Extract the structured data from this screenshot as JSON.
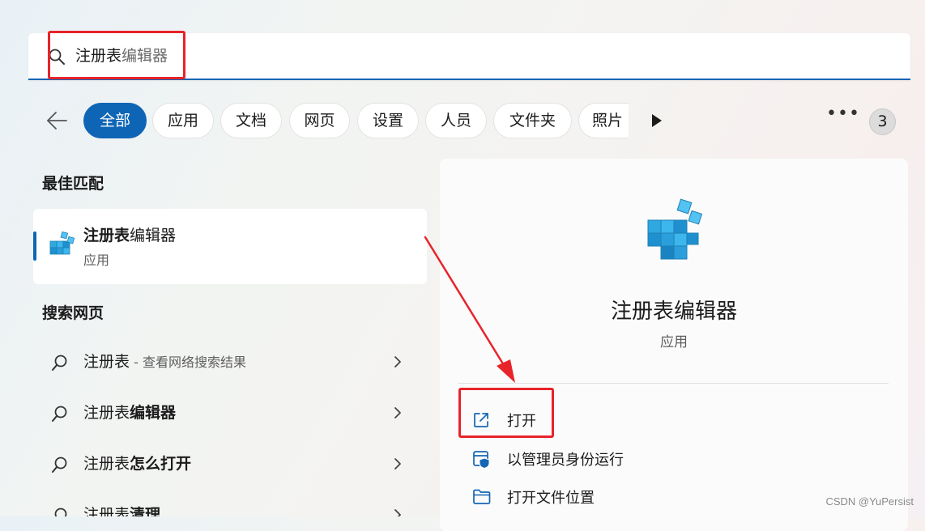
{
  "search": {
    "typed": "注册表",
    "suggestion": "编辑器"
  },
  "filters": {
    "items": [
      "全部",
      "应用",
      "文档",
      "网页",
      "设置",
      "人员",
      "文件夹",
      "照片"
    ],
    "active": "全部",
    "more_label": "•••",
    "count_badge": "3"
  },
  "best_match": {
    "section_title": "最佳匹配",
    "name_highlight": "注册表",
    "name_rest": "编辑器",
    "type": "应用"
  },
  "web_search": {
    "section_title": "搜索网页",
    "results": [
      {
        "prefix": "注册表",
        "suffix": "",
        "hint": " - 查看网络搜索结果"
      },
      {
        "prefix": "注册表",
        "suffix": "编辑器",
        "hint": ""
      },
      {
        "prefix": "注册表",
        "suffix": "怎么打开",
        "hint": ""
      },
      {
        "prefix": "注册表",
        "suffix": "清理",
        "hint": ""
      }
    ]
  },
  "detail": {
    "name": "注册表编辑器",
    "type": "应用",
    "actions": [
      {
        "label": "打开",
        "icon": "open-external-icon"
      },
      {
        "label": "以管理员身份运行",
        "icon": "run-as-admin-icon"
      },
      {
        "label": "打开文件位置",
        "icon": "folder-icon"
      }
    ]
  },
  "colors": {
    "accent": "#0f65b5",
    "annotation": "#e8232a"
  },
  "watermark": "CSDN @YuPersist"
}
